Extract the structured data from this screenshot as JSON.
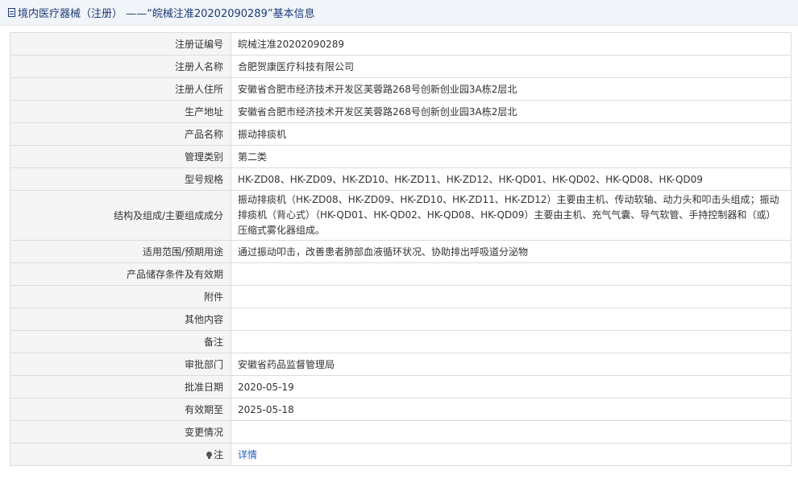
{
  "header": {
    "title": "境内医疗器械（注册） ——“皖械注准20202090289”基本信息",
    "icon": "document-icon"
  },
  "rows": [
    {
      "key": "注册证编号",
      "value": "皖械注准20202090289"
    },
    {
      "key": "注册人名称",
      "value": "合肥贺康医疗科技有限公司"
    },
    {
      "key": "注册人住所",
      "value": "安徽省合肥市经济技术开发区芙蓉路268号创新创业园3A栋2层北"
    },
    {
      "key": "生产地址",
      "value": "安徽省合肥市经济技术开发区芙蓉路268号创新创业园3A栋2层北"
    },
    {
      "key": "产品名称",
      "value": "振动排痰机"
    },
    {
      "key": "管理类别",
      "value": "第二类"
    },
    {
      "key": "型号规格",
      "value": "HK-ZD08、HK-ZD09、HK-ZD10、HK-ZD11、HK-ZD12、HK-QD01、HK-QD02、HK-QD08、HK-QD09"
    },
    {
      "key": "结构及组成/主要组成成分",
      "value": "振动排痰机（HK-ZD08、HK-ZD09、HK-ZD10、HK-ZD11、HK-ZD12）主要由主机、传动软轴、动力头和叩击头组成；振动排痰机（背心式）（HK-QD01、HK-QD02、HK-QD08、HK-QD09）主要由主机、充气气囊、导气软管、手持控制器和（或）压缩式雾化器组成。"
    },
    {
      "key": "适用范围/预期用途",
      "value": "通过振动叩击，改善患者肺部血液循环状况、协助排出呼吸道分泌物"
    },
    {
      "key": "产品储存条件及有效期",
      "value": ""
    },
    {
      "key": "附件",
      "value": ""
    },
    {
      "key": "其他内容",
      "value": ""
    },
    {
      "key": "备注",
      "value": ""
    },
    {
      "key": "审批部门",
      "value": "安徽省药品监督管理局"
    },
    {
      "key": "批准日期",
      "value": "2020-05-19"
    },
    {
      "key": "有效期至",
      "value": "2025-05-18"
    },
    {
      "key": "变更情况",
      "value": ""
    },
    {
      "key": "注",
      "value": "详情",
      "icon": "lightbulb-icon"
    }
  ]
}
